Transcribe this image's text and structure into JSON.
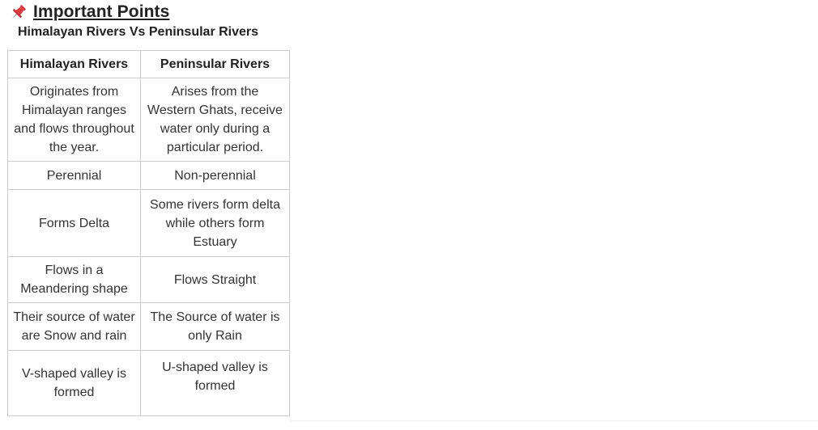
{
  "heading": {
    "icon": "pushpin-icon",
    "icon_color": "#e0393e",
    "title": "Important Points"
  },
  "subtitle": "Himalayan Rivers Vs Peninsular Rivers",
  "table": {
    "headers": [
      "Himalayan Rivers",
      "Peninsular Rivers"
    ],
    "rows": [
      [
        "Originates from Himalayan ranges and flows throughout the year.",
        "Arises from the Western Ghats, receive water only during a particular period."
      ],
      [
        "Perennial",
        "Non-perennial"
      ],
      [
        "Forms Delta",
        "Some rivers form delta while others form Estuary"
      ],
      [
        "Flows in a Meandering shape",
        "Flows Straight"
      ],
      [
        "Their source of water are Snow and rain",
        "The Source of water is only Rain"
      ],
      [
        "V-shaped valley is formed",
        "U-shaped valley is formed"
      ]
    ]
  },
  "colors": {
    "border": "#cccccc",
    "text": "#333333"
  }
}
